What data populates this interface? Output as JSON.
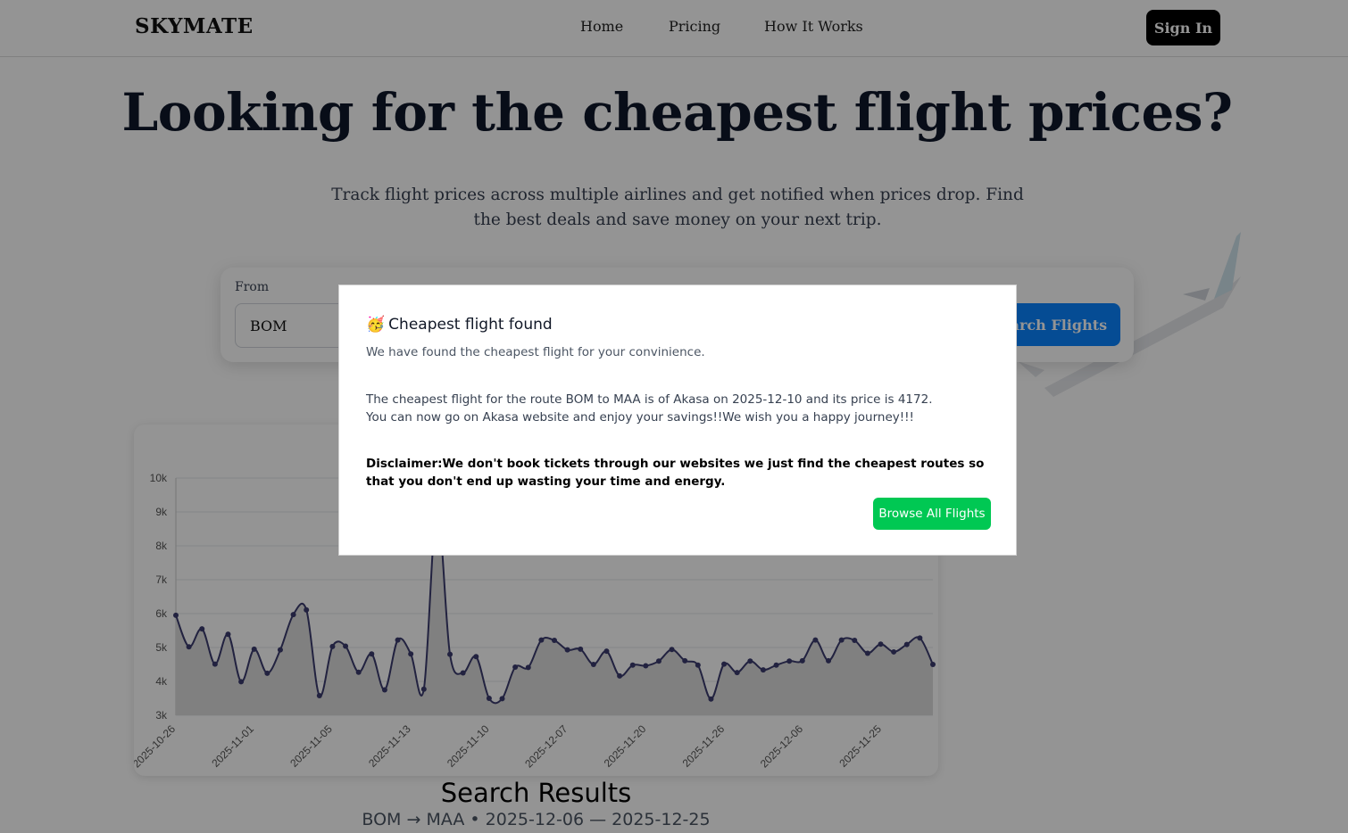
{
  "navbar": {
    "brand": "SKYMATE",
    "links": [
      "Home",
      "Pricing",
      "How It Works"
    ],
    "signin_label": "Sign In"
  },
  "hero": {
    "title": "Looking for the cheapest flight prices?",
    "subtitle": "Track flight prices across multiple airlines and get notified when prices drop. Find the best deals and save money on your next trip."
  },
  "search": {
    "from_label": "From",
    "from_value": "BOM",
    "button_label": "Search Flights"
  },
  "chart_data": {
    "type": "area",
    "title": "",
    "xlabel": "",
    "ylabel": "",
    "ylim": [
      3000,
      10000
    ],
    "yticks": [
      "3k",
      "4k",
      "5k",
      "6k",
      "7k",
      "8k",
      "9k",
      "10k"
    ],
    "x_tick_labels": [
      "2025-10-26",
      "2025-11-01",
      "2025-11-05",
      "2025-11-13",
      "2025-11-10",
      "2025-12-07",
      "2025-11-20",
      "2025-11-26",
      "2025-12-06",
      "2025-11-25"
    ],
    "series": [
      {
        "values": [
          5950,
          5020,
          5550,
          4510,
          5390,
          3990,
          4950,
          4240,
          4930,
          5970,
          6110,
          3580,
          5030,
          5040,
          4270,
          4810,
          3750,
          5220,
          4810,
          3770,
          9100,
          4800,
          4250,
          4730,
          3500,
          3490,
          4420,
          4410,
          5220,
          5210,
          4930,
          4950,
          4500,
          4890,
          4160,
          4480,
          4460,
          4600,
          4940,
          4610,
          4480,
          3480,
          4510,
          4260,
          4600,
          4340,
          4480,
          4600,
          4610,
          5220,
          4610,
          5220,
          5210,
          4830,
          5100,
          4870,
          5090,
          5280,
          4500
        ],
        "color": "#3b3c6e"
      }
    ],
    "grid": true,
    "legend": "none"
  },
  "results": {
    "title": "Search Results",
    "route": "BOM → MAA • 2025-12-06 — 2025-12-25"
  },
  "modal": {
    "emoji": "🥳",
    "title": "Cheapest flight found",
    "subtitle": "We have found the cheapest flight for your convinience.",
    "body_line1": "The cheapest flight for the route BOM to MAA is of Akasa on 2025-12-10 and its price is 4172.",
    "body_line2": "You can now go on Akasa website and enjoy your savings!!We wish you a happy journey!!!",
    "disclaimer": "Disclaimer:We don't book tickets through our websites we just find the cheapest routes so that you don't end up wasting your time and energy.",
    "button_label": "Browse All Flights",
    "button_color": "#00c853"
  }
}
